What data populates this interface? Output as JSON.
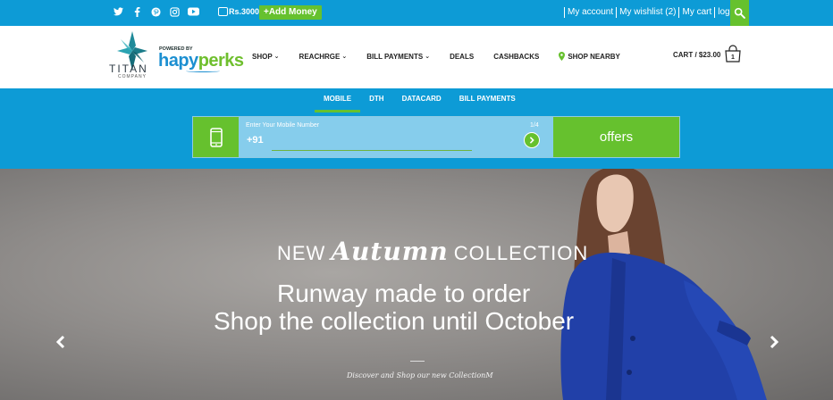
{
  "topbar": {
    "social_icons": [
      "twitter-icon",
      "facebook-icon",
      "pinterest-icon",
      "instagram-icon",
      "youtube-icon"
    ],
    "wallet_amount": "Rs.3000",
    "add_money": "+Add Money",
    "links": [
      "My account",
      "My wishlist (2)",
      "My cart",
      "login"
    ]
  },
  "brand": {
    "titan": "TITAN",
    "titan_sub": "COMPANY",
    "powered_by": "POWERED BY",
    "hapy": "hapy",
    "perks": "perks"
  },
  "nav": {
    "items": [
      "SHOP",
      "REACHRGE",
      "BILL PAYMENTS",
      "DEALS",
      "CASHBACKS",
      "SHOP NEARBY"
    ]
  },
  "cart": {
    "label": "CART / $23.00",
    "count": "1"
  },
  "tabs": [
    "MOBILE",
    "DTH",
    "DATACARD",
    "BILL PAYMENTS"
  ],
  "recharge": {
    "placeholder": "Enter Your Mobile Number",
    "prefix": "+91",
    "step": "1/4",
    "offers": "offers"
  },
  "hero": {
    "kicker_pre": "NEW",
    "kicker_script": "Autumn",
    "kicker_post": "COLLECTION",
    "line1": "Runway made to order",
    "line2": "Shop the collection until October",
    "caption": "Discover and Shop our new CollectionM"
  },
  "colors": {
    "primary": "#0d9bd6",
    "accent": "#66c12e"
  }
}
